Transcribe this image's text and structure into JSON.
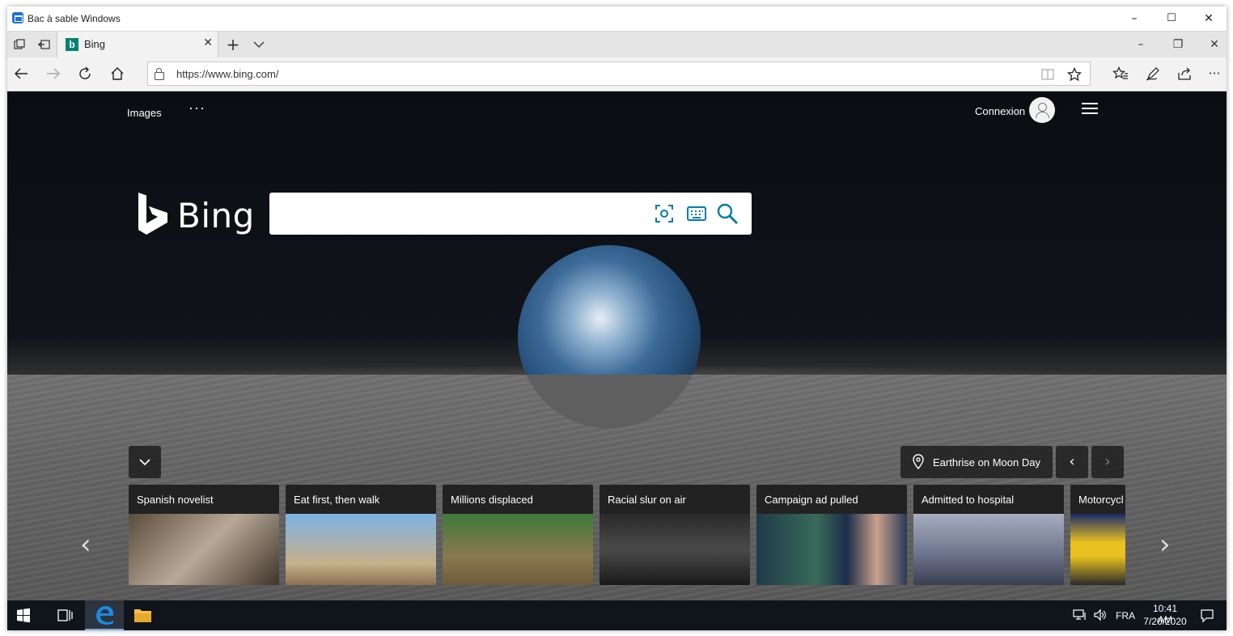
{
  "sandbox": {
    "title": "Bac à sable Windows",
    "minimize": "–",
    "maximize": "☐",
    "close": "✕"
  },
  "browser": {
    "tab": {
      "title": "Bing",
      "favicon_letter": "b",
      "close": "✕"
    },
    "new_tab": "+",
    "tab_menu": "⌵",
    "window": {
      "minimize": "–",
      "restore": "❐",
      "close": "✕"
    },
    "url": "https://www.bing.com/",
    "icons": [
      "tabs-aside-icon",
      "set-aside-icon",
      "back-icon",
      "forward-icon",
      "refresh-icon",
      "home-icon",
      "lock-icon",
      "reading-view-icon",
      "favorite-star-icon",
      "favorites-icon",
      "notes-icon",
      "share-icon",
      "more-icon"
    ]
  },
  "bing": {
    "nav_images": "Images",
    "nav_more": "···",
    "signin": "Connexion",
    "logo_text": "Bing",
    "search_placeholder": "",
    "location_text": "Earthrise on Moon Day",
    "prev_arrow": "‹",
    "next_arrow": "›",
    "cards": [
      {
        "title": "Spanish novelist",
        "color": "#7a6a5a"
      },
      {
        "title": "Eat first, then walk",
        "color": "#6a9bd0"
      },
      {
        "title": "Millions displaced",
        "color": "#8a7a4a"
      },
      {
        "title": "Racial slur on air",
        "color": "#3a3a3a"
      },
      {
        "title": "Campaign ad pulled",
        "color": "#2e4a6a"
      },
      {
        "title": "Admitted to hospital",
        "color": "#8a8fa0"
      },
      {
        "title": "Motorcycl",
        "color": "#c9a020"
      }
    ]
  },
  "taskbar": {
    "language": "FRA",
    "time": "10:41 AM",
    "date": "7/20/2020"
  },
  "colors": {
    "bing_teal": "#008373",
    "taskbar": "#10151c",
    "edge_blue": "#0078d7"
  }
}
